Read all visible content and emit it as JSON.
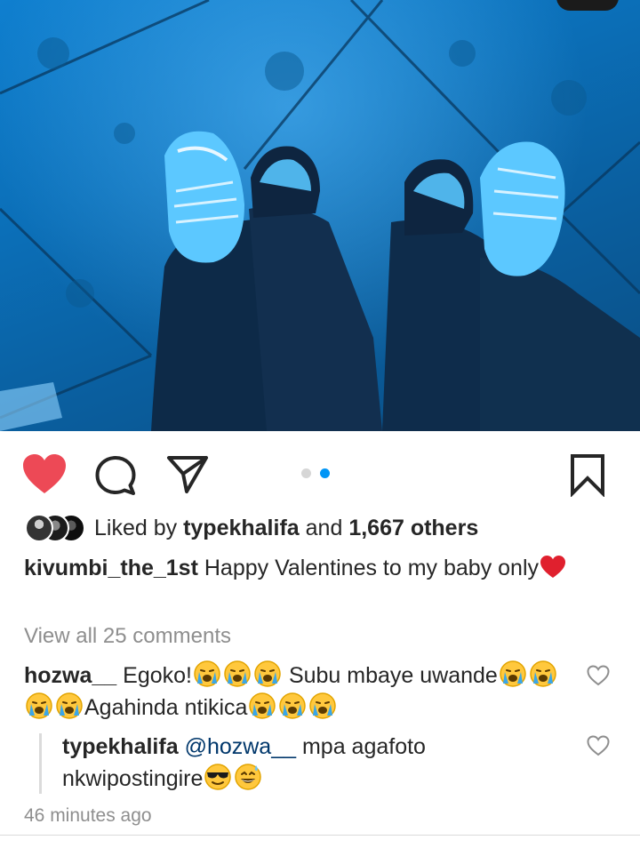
{
  "post": {
    "carousel": {
      "total_slides": 2,
      "active_slide": 2
    },
    "likes": {
      "prefix": "Liked by",
      "user": "typekhalifa",
      "joiner": "and",
      "others": "1,667 others"
    },
    "caption": {
      "username": "kivumbi_the_1st",
      "text": "Happy Valentines to my baby only"
    },
    "view_all": "View all 25 comments",
    "comments": [
      {
        "username": "hozwa__",
        "part1": "Egoko!",
        "part2": "Subu mbaye uwande",
        "part3": "Agahinda ntikica"
      },
      {
        "username": "typekhalifa",
        "mention": "@hozwa__",
        "text": "mpa agafoto nkwipostingire"
      }
    ],
    "timestamp": "46 minutes ago"
  },
  "icons": {
    "like": "heart-filled-icon",
    "comment": "comment-bubble-icon",
    "share": "paper-plane-icon",
    "save": "bookmark-icon",
    "comment_like": "heart-outline-icon"
  },
  "colors": {
    "like_red": "#ed4956",
    "carousel_active": "#0095f6",
    "mention_blue": "#00376b",
    "muted_gray": "#8e8e8e"
  }
}
